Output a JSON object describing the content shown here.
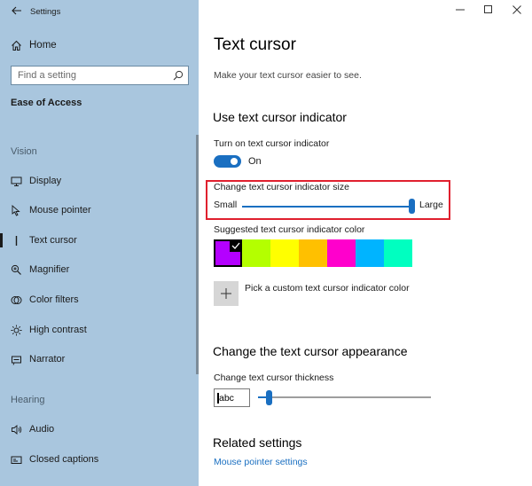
{
  "window": {
    "app_title": "Settings",
    "controls": [
      "minimize-icon",
      "maximize-icon",
      "close-icon"
    ]
  },
  "sidebar": {
    "home_label": "Home",
    "search_placeholder": "Find a setting",
    "section_title": "Ease of Access",
    "groups": [
      {
        "label": "Vision"
      },
      {
        "label": "Hearing"
      }
    ],
    "items": [
      {
        "label": "Display",
        "icon": "display-icon"
      },
      {
        "label": "Mouse pointer",
        "icon": "mouse-pointer-icon"
      },
      {
        "label": "Text cursor",
        "icon": "text-cursor-icon",
        "selected": true
      },
      {
        "label": "Magnifier",
        "icon": "magnifier-icon"
      },
      {
        "label": "Color filters",
        "icon": "color-filters-icon"
      },
      {
        "label": "High contrast",
        "icon": "high-contrast-icon"
      },
      {
        "label": "Narrator",
        "icon": "narrator-icon"
      },
      {
        "label": "Audio",
        "icon": "audio-icon"
      },
      {
        "label": "Closed captions",
        "icon": "closed-captions-icon"
      }
    ]
  },
  "main": {
    "title": "Text cursor",
    "subtitle": "Make your text cursor easier to see.",
    "indicator_section": {
      "heading": "Use text cursor indicator",
      "toggle_label": "Turn on text cursor indicator",
      "toggle_state": "On",
      "size_label": "Change text cursor indicator size",
      "size_min_label": "Small",
      "size_max_label": "Large",
      "size_value": 1.0,
      "color_label": "Suggested text cursor indicator color",
      "colors": [
        "#b400ff",
        "#b4ff00",
        "#ffff00",
        "#ffc000",
        "#ff00cc",
        "#00b4ff",
        "#00ffc0"
      ],
      "selected_color_index": 0,
      "custom_color_label": "Pick a custom text cursor indicator color"
    },
    "appearance_section": {
      "heading": "Change the text cursor appearance",
      "thickness_label": "Change text cursor thickness",
      "preview_text": "abc",
      "thickness_value": 0.06
    },
    "related": {
      "heading": "Related settings",
      "link_label": "Mouse pointer settings"
    }
  },
  "accent_color": "#1a6fc1",
  "highlight_color": "#e0202e"
}
